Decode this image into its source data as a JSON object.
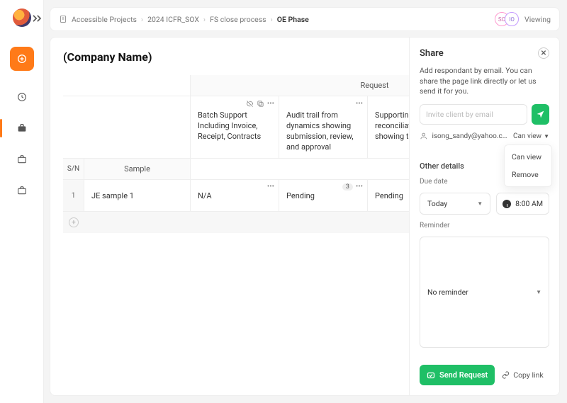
{
  "breadcrumb": {
    "root_icon": "document-icon",
    "items": [
      "Accessible Projects",
      "2024 ICFR_SOX",
      "FS close process"
    ],
    "current": "OE Phase"
  },
  "topbar": {
    "viewing_label": "Viewing",
    "avatars": [
      "SO",
      "IO"
    ]
  },
  "page_title": "(Company Name)",
  "table": {
    "group_header": "Request",
    "headers": {
      "sn": "S/N",
      "sample": "Sample"
    },
    "requests": [
      {
        "title": "Batch Support Including Invoice, Receipt, Contracts",
        "badge": null,
        "icons": [
          "eye-off-icon",
          "copy-icon",
          "more-icon"
        ]
      },
      {
        "title": "Audit trail from dynamics showing submission, review, and approval",
        "badge": null,
        "icons": [
          "more-icon"
        ]
      },
      {
        "title": "Supporting reconciliation report, showing that t",
        "badge": null,
        "icons": [
          "more-icon"
        ]
      }
    ],
    "rows": [
      {
        "sn": "1",
        "sample": "JE sample 1",
        "cells": [
          {
            "value": "N/A",
            "badge": null,
            "more": true
          },
          {
            "value": "Pending",
            "badge": "3",
            "more": true
          },
          {
            "value": "Pending",
            "badge": null,
            "more": true
          }
        ]
      }
    ]
  },
  "share": {
    "title": "Share",
    "desc": "Add respondant by email. You can share the page link directly or let us send it for you.",
    "invite_placeholder": "Invite client by email",
    "respondent_email": "isong_sandy@yahoo.com",
    "permission_label": "Can view",
    "permission_menu": [
      "Can view",
      "Remove"
    ],
    "other_details_label": "Other details",
    "due_date_label": "Due date",
    "due_date_value": "Today",
    "time_value": "8:00 AM",
    "reminder_label": "Reminder",
    "reminder_value": "No reminder",
    "send_request_label": "Send Request",
    "copy_link_label": "Copy link"
  }
}
